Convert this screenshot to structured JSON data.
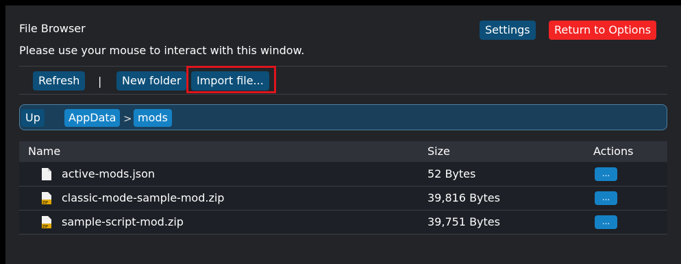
{
  "window": {
    "title": "File Browser",
    "subtitle": "Please use your mouse to interact with this window."
  },
  "header": {
    "settings_label": "Settings",
    "return_label": "Return to Options"
  },
  "toolbar": {
    "refresh_label": "Refresh",
    "separator": "|",
    "new_folder_label": "New folder",
    "import_label": "Import file..."
  },
  "path": {
    "up_label": "Up",
    "crumbs": [
      "AppData",
      "mods"
    ],
    "separator": ">"
  },
  "table": {
    "columns": [
      "Name",
      "Size",
      "Actions"
    ],
    "rows": [
      {
        "name": "active-mods.json",
        "size": "52 Bytes",
        "icon": "document-icon",
        "action": "..."
      },
      {
        "name": "classic-mode-sample-mod.zip",
        "size": "39,816 Bytes",
        "icon": "zip-file-icon",
        "action": "..."
      },
      {
        "name": "sample-script-mod.zip",
        "size": "39,751 Bytes",
        "icon": "zip-file-icon",
        "action": "..."
      }
    ]
  },
  "colors": {
    "button_blue": "#0d4f78",
    "button_red": "#f22424",
    "crumb_blue": "#1682c6",
    "highlight": "#e0141c",
    "background": "#222428"
  }
}
